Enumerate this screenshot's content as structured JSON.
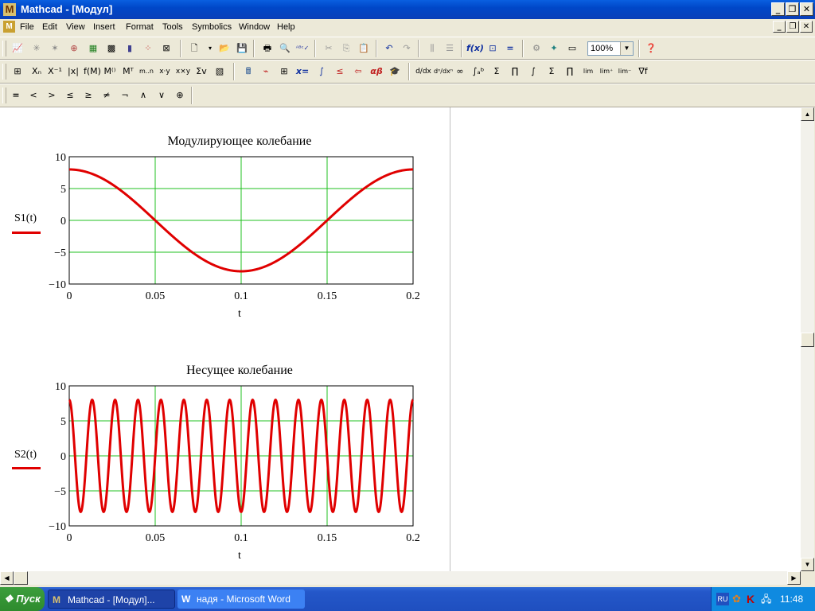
{
  "window": {
    "title": "Mathcad - [Модул]",
    "app_icon": "M"
  },
  "menubar": {
    "items": [
      "File",
      "Edit",
      "View",
      "Insert",
      "Format",
      "Tools",
      "Symbolics",
      "Window",
      "Help"
    ]
  },
  "toolbar": {
    "zoom": "100%"
  },
  "math_toolbar": {
    "alpha": "αβ",
    "x_eq": "x="
  },
  "operators": [
    "=",
    "<",
    ">",
    "≤",
    "≥",
    "≠",
    "¬",
    "∧",
    "∨",
    "⊕"
  ],
  "plots": [
    {
      "title": "Модулирующее колебание",
      "ylabel": "S1(t)",
      "xlabel": "t",
      "yticks": [
        "10",
        "5",
        "0",
        "−5",
        "−10"
      ],
      "xticks": [
        "0",
        "0.05",
        "0.1",
        "0.15",
        "0.2"
      ]
    },
    {
      "title": "Несущее колебание",
      "ylabel": "S2(t)",
      "xlabel": "t",
      "yticks": [
        "10",
        "5",
        "0",
        "−5",
        "−10"
      ],
      "xticks": [
        "0",
        "0.05",
        "0.1",
        "0.15",
        "0.2"
      ]
    }
  ],
  "chart_data": [
    {
      "type": "line",
      "title": "Модулирующее колебание",
      "xlabel": "t",
      "ylabel": "S1(t)",
      "xlim": [
        0,
        0.2
      ],
      "ylim": [
        -10,
        10
      ],
      "grid": true,
      "series": [
        {
          "color": "#e00000",
          "amplitude": 8,
          "frequency": 5,
          "function": "8*cos(2*pi*5*t)"
        }
      ]
    },
    {
      "type": "line",
      "title": "Несущее колебание",
      "xlabel": "t",
      "ylabel": "S2(t)",
      "xlim": [
        0,
        0.2
      ],
      "ylim": [
        -10,
        10
      ],
      "grid": true,
      "series": [
        {
          "color": "#e00000",
          "amplitude": 8,
          "frequency": 75,
          "function": "8*cos(2*pi*75*t)"
        }
      ]
    }
  ],
  "taskbar": {
    "start": "Пуск",
    "tasks": [
      "Mathcad - [Модул]...",
      "надя - Microsoft Word"
    ],
    "lang": "RU",
    "clock": "11:48"
  }
}
